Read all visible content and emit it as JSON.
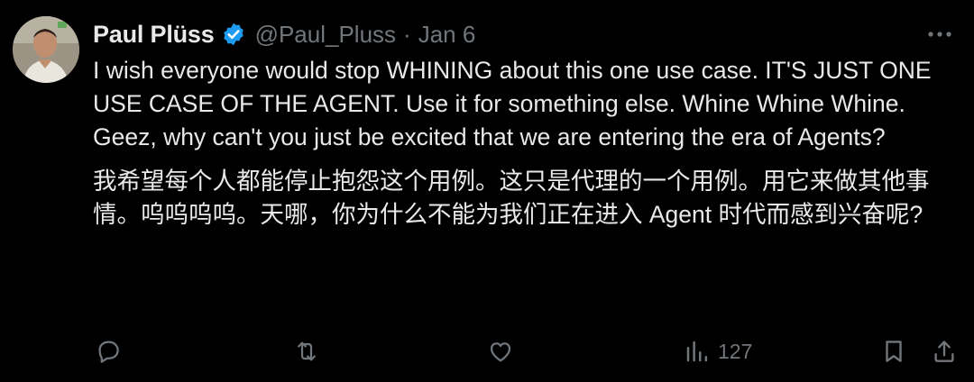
{
  "tweet": {
    "author_name": "Paul Plüss",
    "handle": "@Paul_Pluss",
    "separator": "·",
    "date": "Jan 6",
    "paragraphs": [
      "I wish everyone would stop WHINING about this one use case. IT'S JUST ONE USE CASE OF THE AGENT. Use it for something else. Whine Whine Whine. Geez, why can't you just be excited that we are entering the era of Agents?",
      "我希望每个人都能停止抱怨这个用例。这只是代理的一个用例。用它来做其他事情。呜呜呜呜。天哪，你为什么不能为我们正在进入 Agent 时代而感到兴奋呢?"
    ],
    "icons": {
      "verified": "verified-badge-icon",
      "more": "more-icon",
      "reply": "reply-icon",
      "retweet": "retweet-icon",
      "like": "like-icon",
      "views": "views-icon",
      "bookmark": "bookmark-icon",
      "share": "share-icon"
    },
    "views_count": "127",
    "colors": {
      "background": "#000000",
      "text": "#e7e9ea",
      "secondary": "#71767b",
      "verified": "#1d9bf0"
    }
  }
}
